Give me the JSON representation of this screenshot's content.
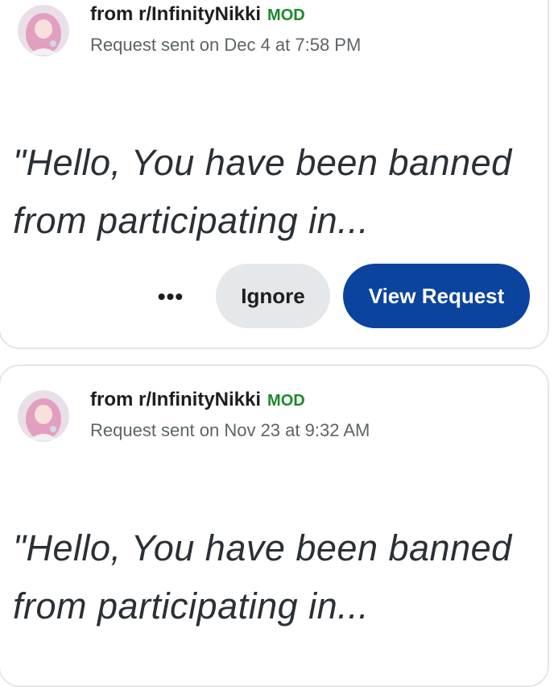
{
  "requests": [
    {
      "sender": "from r/InfinityNikki",
      "badge": "MOD",
      "timestamp": "Request sent on Dec 4 at 7:58 PM",
      "preview_line1": "\"Hello, You have been banned",
      "preview_line2": "from participating in...",
      "more_label": "•••",
      "ignore_label": "Ignore",
      "view_label": "View Request"
    },
    {
      "sender": "from r/InfinityNikki",
      "badge": "MOD",
      "timestamp": "Request sent on Nov 23 at 9:32 AM",
      "preview_line1": "\"Hello, You have been banned",
      "preview_line2": "from participating in..."
    }
  ],
  "colors": {
    "mod_badge": "#1b8a2c",
    "primary_button": "#0b449e",
    "secondary_button": "#e4e8eb"
  },
  "icons": {
    "avatar": "subreddit-avatar",
    "more": "more-options-icon"
  }
}
